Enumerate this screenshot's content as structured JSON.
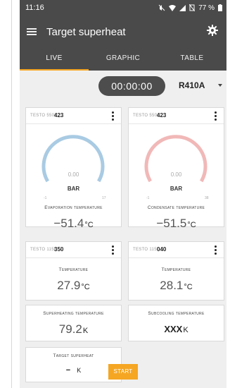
{
  "status": {
    "time": "11:16",
    "battery": "77 %"
  },
  "appbar": {
    "title": "Target superheat",
    "menu_icon": "hamburger-icon",
    "settings_icon": "gear-icon"
  },
  "tabs": [
    {
      "label": "LIVE",
      "active": true
    },
    {
      "label": "GRAPHIC",
      "active": false
    },
    {
      "label": "TABLE",
      "active": false
    }
  ],
  "toolbar": {
    "timer": "00:00:00",
    "refrigerant": "R410A"
  },
  "colors": {
    "accent": "#f5a623",
    "bar": "#4a4a4a",
    "gauge_low": "#a9cbe3",
    "gauge_high": "#f1b8b8"
  },
  "cards": {
    "evap": {
      "brand": "TESTO 550i",
      "id": "423",
      "gauge_value": "0.00",
      "unit": "BAR",
      "min": "-1",
      "max": "17",
      "label": "Evaporation temperature",
      "value": "−51.4",
      "value_unit": "°C"
    },
    "cond": {
      "brand": "TESTO 550i",
      "id": "423",
      "gauge_value": "0.00",
      "unit": "BAR",
      "min": "-1",
      "max": "38",
      "label": "Condensate temperature",
      "value": "−51.5",
      "value_unit": "°C"
    },
    "temp1": {
      "brand": "TESTO 115i",
      "id": "350",
      "label": "Temperature",
      "value": "27.9",
      "value_unit": "°C"
    },
    "temp2": {
      "brand": "TESTO 115i",
      "id": "040",
      "label": "Temperature",
      "value": "28.1",
      "value_unit": "°C"
    },
    "superheat": {
      "label": "Superheating temperature",
      "value": "79.2",
      "value_unit": "K"
    },
    "subcool": {
      "label": "Subcooling temperature",
      "value": "XXX",
      "value_unit": "K"
    },
    "target": {
      "label": "Target superheat",
      "value": "−",
      "value_unit": "K"
    }
  },
  "start_label": "START"
}
